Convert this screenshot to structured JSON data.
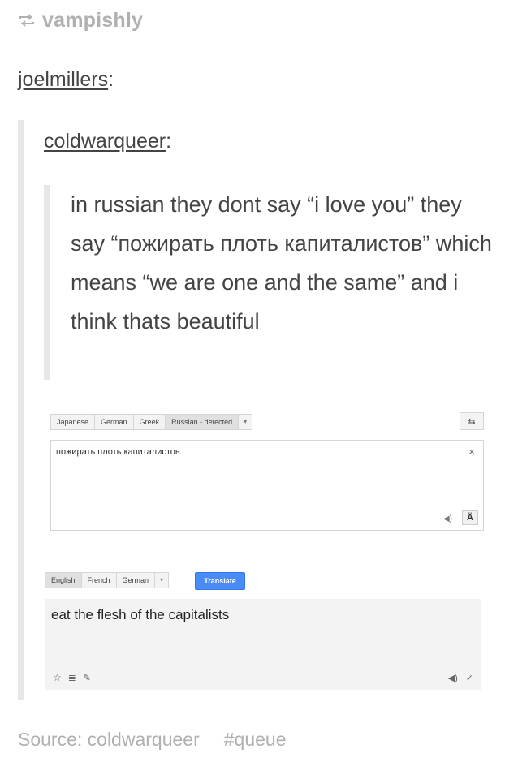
{
  "reblog": {
    "icon": "reblog-icon",
    "username": "vampishly"
  },
  "thread": [
    {
      "username": "joelmillers",
      "suffix": ":"
    },
    {
      "username": "coldwarqueer",
      "suffix": ":"
    }
  ],
  "post": {
    "text": "in russian they dont say “i love you” they say “пожирать плоть капиталистов” which means “we are one and the same” and i think thats beautiful"
  },
  "translate": {
    "source_tabs": [
      "Japanese",
      "German",
      "Greek",
      "Russian - detected"
    ],
    "source_selected": "Russian - detected",
    "dropdown_glyph": "▾",
    "swap_glyph": "⇆",
    "source_text": "пожирать плоть капиталистов",
    "clear_glyph": "×",
    "listen_glyph": "◀)",
    "input_tool_glyph": "Ä",
    "target_tabs": [
      "English",
      "French",
      "German"
    ],
    "target_selected": "English",
    "translate_label": "Translate",
    "result_text": "eat the flesh of the capitalists",
    "result_tools": [
      "☆",
      "≣",
      "✎"
    ],
    "result_right": [
      "◀)",
      "✓"
    ]
  },
  "footer": {
    "source_label": "Source: coldwarqueer",
    "tag": "#queue"
  }
}
